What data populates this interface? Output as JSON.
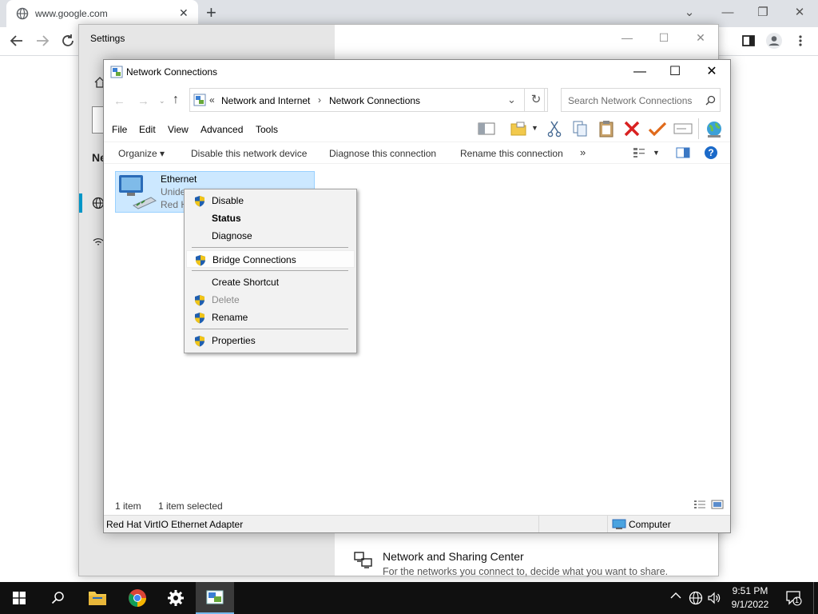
{
  "browser": {
    "tab_title": "www.google.com",
    "tab_close": "✕",
    "new_tab": "+",
    "window_controls": {
      "minimize": "—",
      "restore": "❐",
      "close": "✕"
    },
    "chevron": "⌄"
  },
  "settings": {
    "title": "Settings",
    "partial_heading": "Ne",
    "bottom_item": {
      "title": "Network and Sharing Center",
      "subtitle": "For the networks you connect to, decide what you want to share."
    }
  },
  "explorer": {
    "title": "Network Connections",
    "address": {
      "prefix": "«",
      "crumbs": [
        "Network and Internet",
        "Network Connections"
      ],
      "sep": "›"
    },
    "search_placeholder": "Search Network Connections",
    "menu": [
      "File",
      "Edit",
      "View",
      "Advanced",
      "Tools"
    ],
    "commands": {
      "organize": "Organize ▾",
      "disable": "Disable this network device",
      "diagnose": "Diagnose this connection",
      "rename": "Rename this connection",
      "more": "»"
    },
    "item": {
      "name": "Ethernet",
      "line2": "Unide",
      "line3": "Red H"
    },
    "status": {
      "count": "1 item",
      "selected": "1 item selected"
    },
    "details": {
      "adapter": "Red Hat VirtIO Ethernet Adapter",
      "location": "Computer"
    }
  },
  "context_menu": {
    "items": [
      {
        "label": "Disable",
        "shield": true,
        "state": "normal"
      },
      {
        "label": "Status",
        "shield": false,
        "state": "bold"
      },
      {
        "label": "Diagnose",
        "shield": false,
        "state": "normal"
      },
      {
        "label": "Bridge Connections",
        "shield": true,
        "state": "highlighted"
      },
      {
        "label": "Create Shortcut",
        "shield": false,
        "state": "normal"
      },
      {
        "label": "Delete",
        "shield": true,
        "state": "disabled"
      },
      {
        "label": "Rename",
        "shield": true,
        "state": "normal"
      },
      {
        "label": "Properties",
        "shield": true,
        "state": "normal"
      }
    ]
  },
  "taskbar": {
    "time": "9:51 PM",
    "date": "9/1/2022",
    "notification_count": "1",
    "tray_chevron": "^"
  },
  "colors": {
    "accent": "#0078d7",
    "selection": "#cce8ff",
    "taskbar": "#101010",
    "settings_sidebar": "#e6e6e6"
  }
}
